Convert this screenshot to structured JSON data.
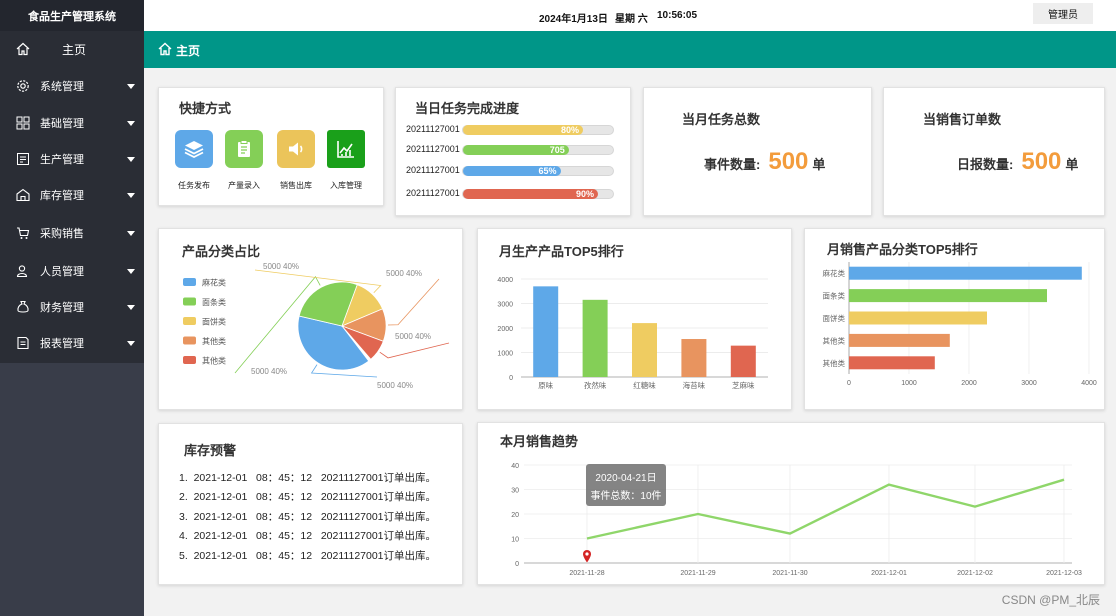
{
  "app": {
    "title": "食品生产管理系统"
  },
  "sidebar": {
    "items": [
      {
        "label": "主页",
        "icon": "home-icon"
      },
      {
        "label": "系统管理",
        "icon": "gear-icon"
      },
      {
        "label": "基础管理",
        "icon": "grid-icon"
      },
      {
        "label": "生产管理",
        "icon": "production-icon"
      },
      {
        "label": "库存管理",
        "icon": "warehouse-icon"
      },
      {
        "label": "采购销售",
        "icon": "cart-icon"
      },
      {
        "label": "人员管理",
        "icon": "users-icon"
      },
      {
        "label": "财务管理",
        "icon": "money-bag-icon"
      },
      {
        "label": "报表管理",
        "icon": "report-icon"
      }
    ]
  },
  "header": {
    "date": "2024年1月13日",
    "weekday": "星期 六",
    "time": "10:56:05",
    "user": "管理员"
  },
  "tabs": {
    "active": "主页"
  },
  "quick": {
    "title": "快捷方式",
    "items": [
      {
        "label": "任务发布",
        "icon": "layers-icon",
        "color": "#5ea8e8"
      },
      {
        "label": "产量录入",
        "icon": "clipboard-icon",
        "color": "#84cf57"
      },
      {
        "label": "销售出库",
        "icon": "speaker-icon",
        "color": "#ebc45a"
      },
      {
        "label": "入库管理",
        "icon": "chart-icon",
        "color": "#1aa01a"
      }
    ]
  },
  "progress": {
    "title": "当日任务完成进度",
    "rows": [
      {
        "id": "20211127001",
        "label": "80%",
        "value": 0.8,
        "color": "#efcc61"
      },
      {
        "id": "20211127001",
        "label": "705",
        "value": 0.705,
        "color": "#84cf57"
      },
      {
        "id": "20211127001",
        "label": "65%",
        "value": 0.65,
        "color": "#5ea8e8"
      },
      {
        "id": "20211127001",
        "label": "90%",
        "value": 0.9,
        "color": "#e06650"
      }
    ]
  },
  "stat_tasks": {
    "title": "当月任务总数",
    "label": "事件数量:",
    "value": "500",
    "unit": "单"
  },
  "stat_orders": {
    "title": "当销售订单数",
    "label": "日报数量:",
    "value": "500",
    "unit": "单"
  },
  "pie_title": "产品分类占比",
  "bar_title": "月生产产品TOP5排行",
  "hbar_title": "月销售产品分类TOP5排行",
  "inventory": {
    "title": "库存预警",
    "lines": [
      "1.  2021-12-01   08：45：12   20211127001订单出库。",
      "2.  2021-12-01   08：45：12   20211127001订单出库。",
      "3.  2021-12-01   08：45：12   20211127001订单出库。",
      "4.  2021-12-01   08：45：12   20211127001订单出库。",
      "5.  2021-12-01   08：45：12   20211127001订单出库。"
    ]
  },
  "trend_title": "本月销售趋势",
  "tooltip": {
    "date": "2020-04-21日",
    "text": "事件总数：10件"
  },
  "watermark": "CSDN @PM_北辰",
  "chart_data": [
    {
      "type": "pie",
      "title": "产品分类占比",
      "legend": [
        "麻花类",
        "面条类",
        "面饼类",
        "其他类",
        "其他类"
      ],
      "legend_placement": "left",
      "values": [
        5000,
        5000,
        5000,
        5000,
        5000
      ],
      "shares": [
        0.39,
        0.27,
        0.13,
        0.12,
        0.08
      ],
      "slice_labels": [
        "5000 40%",
        "5000 40%",
        "5000 40%",
        "5000 40%",
        "5000 40%"
      ],
      "colors": [
        "#5ea8e8",
        "#84cf57",
        "#efcc61",
        "#e8945f",
        "#e06650"
      ]
    },
    {
      "type": "bar",
      "title": "月生产产品TOP5排行",
      "categories": [
        "原味",
        "孜然味",
        "红糖味",
        "海苔味",
        "芝麻味"
      ],
      "values": [
        3700,
        3150,
        2200,
        1550,
        1280
      ],
      "ylim": [
        0,
        4000
      ],
      "yticks": [
        0,
        1000,
        2000,
        3000,
        4000
      ],
      "grid": true,
      "colors": [
        "#5ea8e8",
        "#84cf57",
        "#efcc61",
        "#e8945f",
        "#e06650"
      ]
    },
    {
      "type": "bar",
      "orientation": "horizontal",
      "title": "月销售产品分类TOP5排行",
      "categories": [
        "麻花类",
        "面条类",
        "面饼类",
        "其他类",
        "其他类"
      ],
      "values": [
        3880,
        3300,
        2300,
        1680,
        1430
      ],
      "xlim": [
        0,
        4000
      ],
      "xticks": [
        0,
        1000,
        2000,
        3000,
        4000
      ],
      "grid": true,
      "colors": [
        "#5ea8e8",
        "#84cf57",
        "#efcc61",
        "#e8945f",
        "#e06650"
      ]
    },
    {
      "type": "line",
      "title": "本月销售趋势",
      "x": [
        "2021-11-28",
        "2021-11-29",
        "2021-11-30",
        "2021-12-01",
        "2021-12-02",
        "2021-12-03"
      ],
      "values": [
        10,
        20,
        12,
        32,
        23,
        34
      ],
      "ylim": [
        0,
        40
      ],
      "yticks": [
        0,
        10,
        20,
        30,
        40
      ],
      "grid": true,
      "color": "#8fd66a"
    }
  ]
}
